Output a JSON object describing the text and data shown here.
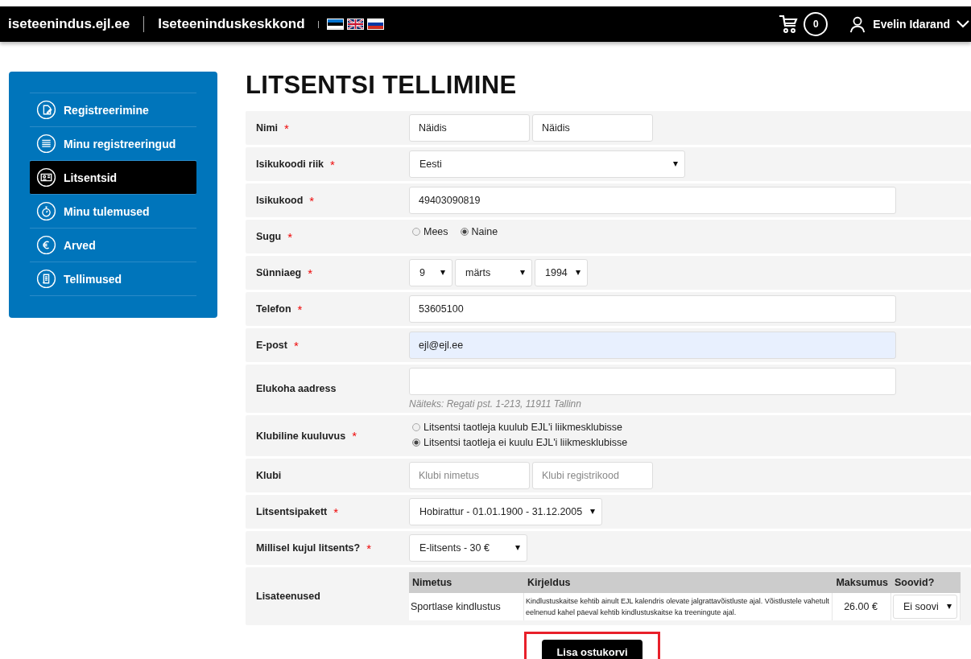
{
  "header": {
    "site": "iseteenindus.ejl.ee",
    "title": "Iseteeninduskeskkond",
    "cart_count": "0",
    "user": "Evelin Idarand"
  },
  "sidebar": {
    "items": [
      {
        "label": "Registreerimine",
        "selected": false
      },
      {
        "label": "Minu registreeringud",
        "selected": false
      },
      {
        "label": "Litsentsid",
        "selected": true
      },
      {
        "label": "Minu tulemused",
        "selected": false
      },
      {
        "label": "Arved",
        "selected": false
      },
      {
        "label": "Tellimused",
        "selected": false
      }
    ]
  },
  "page_title": "LITSENTSI TELLIMINE",
  "rows": [
    {
      "kind": "text",
      "label": "Nimi",
      "required_mark": "*",
      "fields": [
        {
          "value": "Näidis",
          "autofilled": false
        },
        {
          "value": "Näidis",
          "autofilled": false
        }
      ]
    },
    {
      "kind": "select",
      "label": "Isikukoodi riik",
      "required_mark": "*",
      "selects": [
        {
          "value": "Eesti"
        }
      ]
    },
    {
      "kind": "text",
      "label": "Isikukood",
      "required_mark": "*",
      "fields": [
        {
          "value": "49403090819",
          "autofilled": false
        }
      ]
    },
    {
      "kind": "radio",
      "label": "Sugu",
      "required_mark": "*",
      "options": [
        {
          "label": "Mees",
          "selected": false
        },
        {
          "label": "Naine",
          "selected": true
        }
      ]
    },
    {
      "kind": "select",
      "label": "Sünniaeg",
      "required_mark": "*",
      "selects": [
        {
          "value": "9"
        },
        {
          "value": "märts"
        },
        {
          "value": "1994"
        }
      ]
    },
    {
      "kind": "text",
      "label": "Telefon",
      "required_mark": "*",
      "fields": [
        {
          "value": "53605100",
          "autofilled": false
        }
      ]
    },
    {
      "kind": "text",
      "label": "E-post",
      "required_mark": "*",
      "fields": [
        {
          "value": "ejl@ejl.ee",
          "autofilled": true
        }
      ]
    },
    {
      "kind": "text",
      "label": "Elukoha aadress",
      "fields": [
        {
          "autofilled": false
        }
      ],
      "hint": "Näiteks: Regati pst. 1-213, 11911 Tallinn"
    },
    {
      "kind": "radio_list",
      "label": "Klubiline kuuluvus",
      "required_mark": "*",
      "options": [
        {
          "label": "Litsentsi taotleja kuulub EJL'i liikmesklubisse",
          "selected": false
        },
        {
          "label": "Litsentsi taotleja ei kuulu EJL'i liikmesklubisse",
          "selected": true
        }
      ]
    },
    {
      "kind": "text",
      "label": "Klubi",
      "fields": [
        {
          "placeholder": "Klubi nimetus",
          "autofilled": false
        },
        {
          "placeholder": "Klubi registrikood",
          "autofilled": false
        }
      ]
    },
    {
      "kind": "select",
      "label": "Litsentsipakett",
      "required_mark": "*",
      "selects": [
        {
          "value": "Hobirattur - 01.01.1900 - 31.12.2005"
        }
      ]
    },
    {
      "kind": "select",
      "label": "Millisel kujul litsents?",
      "required_mark": "*",
      "selects": [
        {
          "value": "E-litsents - 30 €"
        }
      ]
    },
    {
      "kind": "table",
      "label": "Lisateenused",
      "table": {
        "columns": [
          "Nimetus",
          "Kirjeldus",
          "Maksumus",
          "Soovid?"
        ],
        "rows": [
          {
            "name": "Sportlase kindlustus",
            "description": "Kindlustuskaitse kehtib ainult EJL kalendris olevate jalgrattavõistluste ajal. Võistlustele vahetult eelnenud kahel päeval kehtib kindlustuskaitse ka treeningute ajal.",
            "price": "26.00 €",
            "choice": "Ei soovi"
          }
        ]
      }
    }
  ],
  "submit": {
    "label": "Lisa ostukorvi",
    "highlighted": true
  }
}
